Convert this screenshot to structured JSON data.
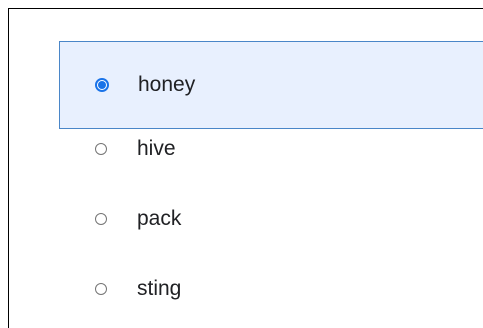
{
  "radio_group": {
    "options": [
      {
        "label": "honey",
        "selected": true
      },
      {
        "label": "hive",
        "selected": false
      },
      {
        "label": "pack",
        "selected": false
      },
      {
        "label": "sting",
        "selected": false
      }
    ]
  },
  "colors": {
    "selected_bg": "#e8f0fe",
    "selected_border": "#4a86c8",
    "accent": "#1a73e8"
  }
}
